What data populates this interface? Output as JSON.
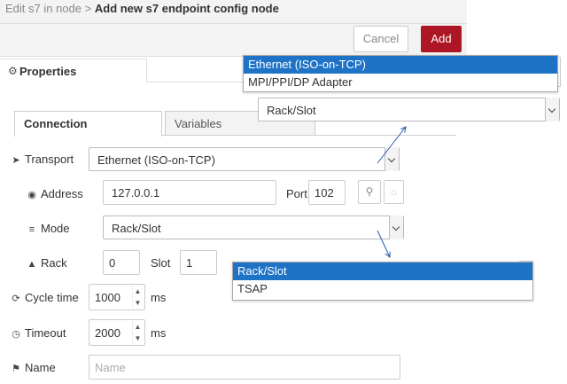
{
  "header": {
    "breadcrumb_parent": "Edit s7 in node",
    "breadcrumb_separator": ">",
    "title": "Add new s7 endpoint config node"
  },
  "toolbar": {
    "cancel_label": "Cancel",
    "add_label": "Add"
  },
  "properties_tab": {
    "label": "Properties"
  },
  "tabs": [
    {
      "label": "Connection",
      "active": true
    },
    {
      "label": "Variables",
      "active": false
    }
  ],
  "form": {
    "transport": {
      "label": "Transport",
      "value": "Ethernet (ISO-on-TCP)"
    },
    "address": {
      "label": "Address",
      "value": "127.0.0.1"
    },
    "port": {
      "label": "Port",
      "value": "102"
    },
    "mode": {
      "label": "Mode",
      "value": "Rack/Slot"
    },
    "rack": {
      "label": "Rack",
      "value": "0"
    },
    "slot": {
      "label": "Slot",
      "value": "1"
    },
    "cycle_time": {
      "label": "Cycle time",
      "value": "1000",
      "unit": "ms"
    },
    "timeout": {
      "label": "Timeout",
      "value": "2000",
      "unit": "ms"
    },
    "name": {
      "label": "Name",
      "placeholder": "Name"
    }
  },
  "callouts": {
    "transport_options": [
      "Ethernet (ISO-on-TCP)",
      "MPI/PPI/DP Adapter"
    ],
    "transport_selected": "Ethernet (ISO-on-TCP)",
    "mode_preview_value": "Rack/Slot",
    "mode_options": [
      "Rack/Slot",
      "TSAP"
    ],
    "mode_selected": "Rack/Slot"
  },
  "colors": {
    "accent_red": "#ad1625",
    "selection_blue": "#1e73c6",
    "arrow_blue": "#2a5aa8"
  },
  "icons": {
    "properties": "gear-icon",
    "transport": "plug-icon",
    "address": "globe-icon",
    "mode": "sliders-icon",
    "rack": "sitemap-icon",
    "cycle_time": "refresh-icon",
    "timeout": "clock-icon",
    "name": "tag-icon",
    "lookup": "search-icon",
    "hint": "lightbulb-icon"
  }
}
